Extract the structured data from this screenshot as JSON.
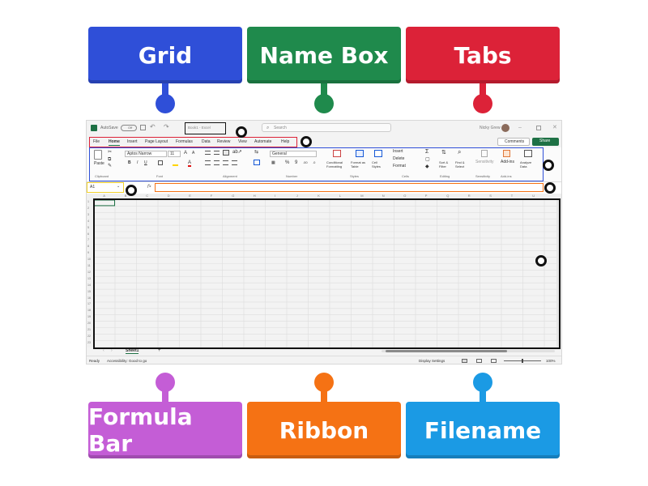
{
  "labels": {
    "grid": "Grid",
    "name_box": "Name Box",
    "tabs": "Tabs",
    "formula_bar": "Formula Bar",
    "ribbon": "Ribbon",
    "filename": "Filename"
  },
  "colors": {
    "grid": "#2f4fd8",
    "name_box": "#1f8a4c",
    "tabs": "#dc2238",
    "formula_bar": "#c45dd6",
    "ribbon": "#f57214",
    "filename": "#1b9ae4",
    "excel_green": "#1e7145",
    "accent_blue": "#1558d6"
  },
  "excel": {
    "autosave": "AutoSave",
    "autosave_state": "Off",
    "filename": "Book1 - Excel",
    "search_placeholder": "Search",
    "user": "Nicky Grew",
    "tabs": [
      "File",
      "Home",
      "Insert",
      "Page Layout",
      "Formulas",
      "Data",
      "Review",
      "View",
      "Automate",
      "Help"
    ],
    "comments": "Comments",
    "share": "Share",
    "ribbon": {
      "paste": "Paste",
      "font_name": "Aptos Narrow",
      "font_size": "11",
      "number_format": "General",
      "conditional_formatting": "Conditional Formatting",
      "format_as_table": "Format as Table",
      "cell_styles": "Cell Styles",
      "insert": "Insert",
      "delete": "Delete",
      "format": "Format",
      "sort_filter": "Sort & Filter",
      "find_select": "Find & Select",
      "sensitivity": "Sensitivity",
      "add_ins": "Add-ins",
      "analyze_data": "Analyze Data",
      "groups": [
        "Clipboard",
        "Font",
        "Alignment",
        "Number",
        "Styles",
        "Cells",
        "Editing",
        "Sensitivity",
        "Add-ins"
      ]
    },
    "name_box_value": "A1",
    "fx": "fx",
    "columns": [
      "A",
      "B",
      "C",
      "D",
      "E",
      "F",
      "G",
      "H",
      "I",
      "J",
      "K",
      "L",
      "M",
      "N",
      "O",
      "P",
      "Q",
      "R",
      "S",
      "T",
      "U"
    ],
    "rows": [
      "1",
      "2",
      "3",
      "4",
      "5",
      "6",
      "7",
      "8",
      "9",
      "10",
      "11",
      "12",
      "13",
      "14",
      "15",
      "16",
      "17",
      "18",
      "19",
      "20",
      "21",
      "22",
      "23"
    ],
    "sheet_tab": "Sheet1",
    "add_sheet": "+",
    "status_ready": "Ready",
    "accessibility": "Accessibility: Good to go",
    "display_settings": "Display Settings",
    "zoom": "100%"
  }
}
